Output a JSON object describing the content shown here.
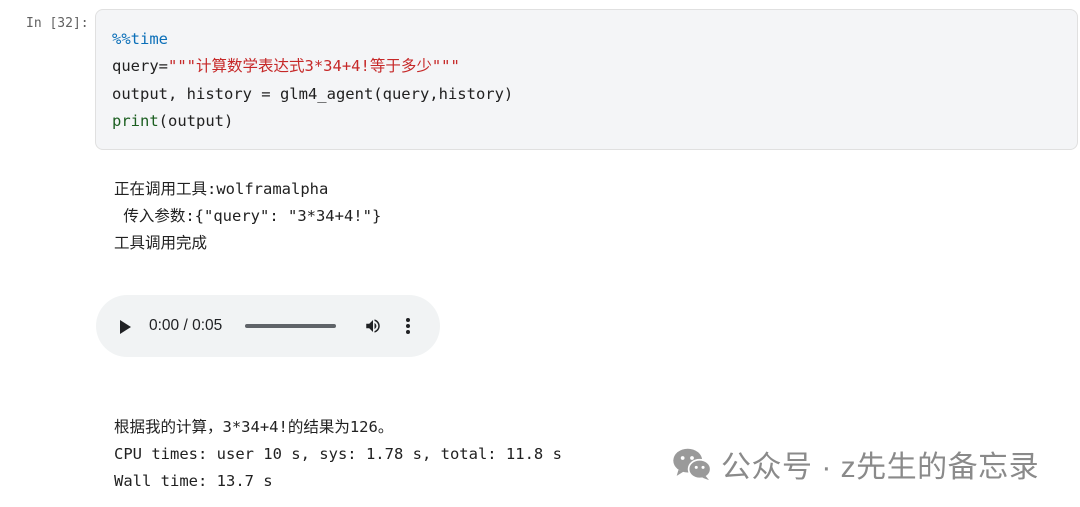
{
  "cell": {
    "prompt": "In [32]:",
    "code": {
      "line1_magic": "%%time",
      "line2_var": "query=",
      "line2_string": "\"\"\"计算数学表达式3*34+4!等于多少\"\"\"",
      "line3": "output, history = glm4_agent(query,history)",
      "line4_func": "print",
      "line4_args": "(output)"
    }
  },
  "output": {
    "tool_call_lines": [
      "正在调用工具:wolframalpha",
      " 传入参数:{\"query\": \"3*34+4!\"}",
      "工具调用完成"
    ],
    "audio_player": {
      "time_display": "0:00 / 0:05",
      "progress": 0,
      "play_icon": "play-icon",
      "volume_icon": "volume-icon",
      "menu_icon": "more-vert-icon"
    },
    "result_lines": [
      "根据我的计算，3*34+4!的结果为126。",
      "CPU times: user 10 s, sys: 1.78 s, total: 11.8 s",
      "Wall time: 13.7 s"
    ]
  },
  "watermark": {
    "icon": "wechat-icon",
    "text": "公众号 · z先生的备忘录"
  }
}
